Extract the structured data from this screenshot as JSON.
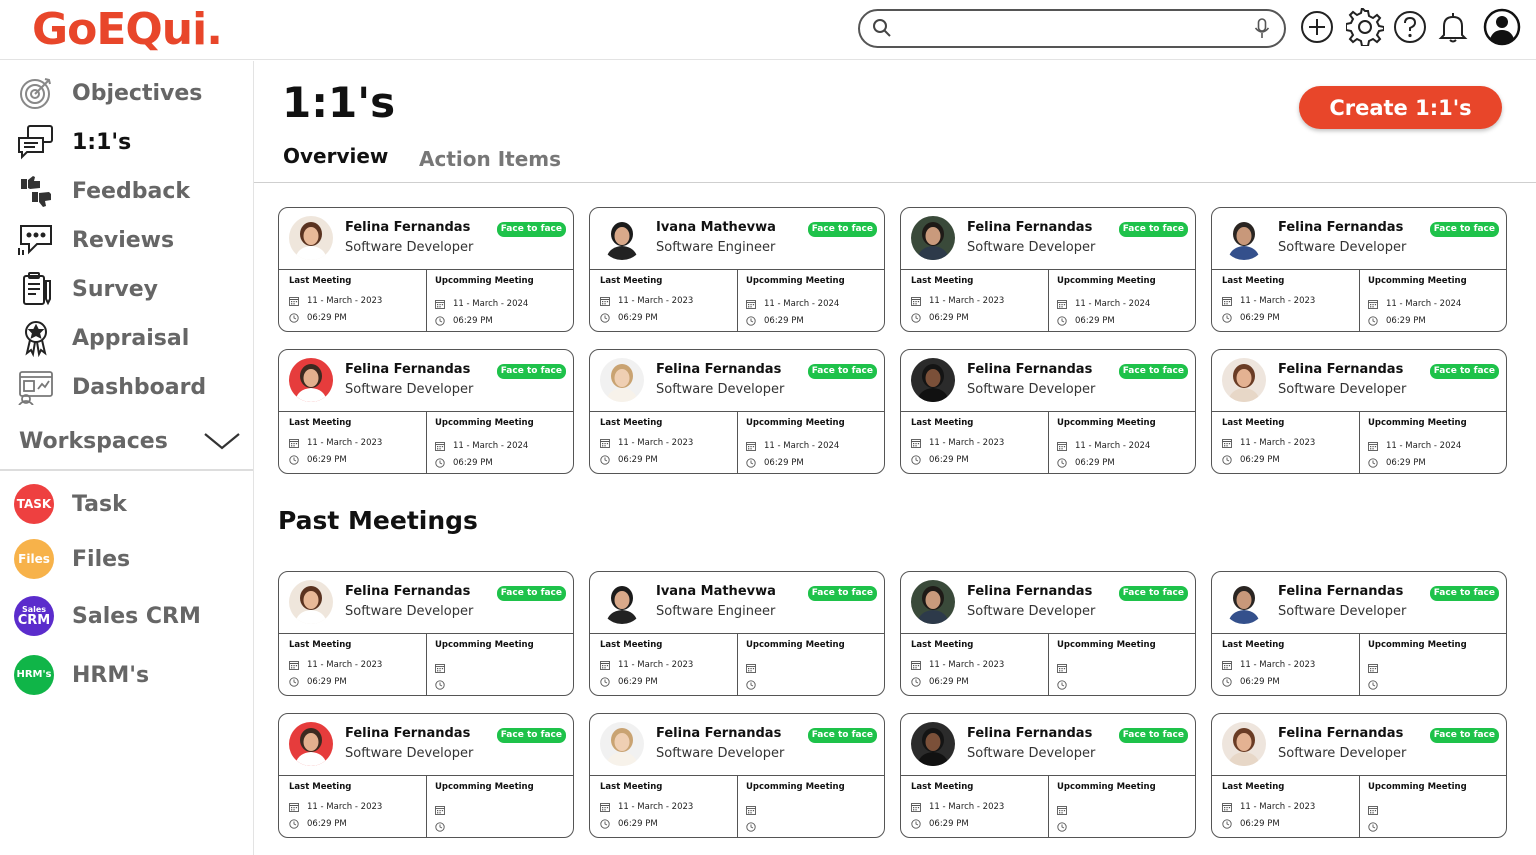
{
  "app": {
    "logo": "GoEQui."
  },
  "search": {
    "placeholder": ""
  },
  "header_icons": [
    "plus-circle-icon",
    "gear-icon",
    "help-icon",
    "bell-icon",
    "user-account-icon"
  ],
  "sidebar": {
    "items": [
      {
        "label": "Objectives",
        "icon": "target-icon"
      },
      {
        "label": "1:1's",
        "icon": "chat-icon",
        "active": true
      },
      {
        "label": "Feedback",
        "icon": "thumbs-icon"
      },
      {
        "label": "Reviews",
        "icon": "review-icon"
      },
      {
        "label": "Survey",
        "icon": "clipboard-icon"
      },
      {
        "label": "Appraisal",
        "icon": "award-icon"
      },
      {
        "label": "Dashboard",
        "icon": "dashboard-icon"
      }
    ],
    "workspaces_label": "Workspaces",
    "workspaces": [
      {
        "label": "Task",
        "badge": "TASK",
        "color": "#ee4040"
      },
      {
        "label": "Files",
        "badge": "Files",
        "color": "#f7b24a"
      },
      {
        "label": "Sales CRM",
        "badge_top": "Sales",
        "badge": "CRM",
        "color": "#5b2ccc"
      },
      {
        "label": "HRM's",
        "badge": "HRM's",
        "color": "#10b548"
      }
    ]
  },
  "main": {
    "title": "1:1's",
    "create_button": "Create 1:1's",
    "tabs": [
      {
        "label": "Overview",
        "active": true
      },
      {
        "label": "Action Items"
      }
    ],
    "past_title": "Past Meetings",
    "labels": {
      "last": "Last Meeting",
      "upcoming": "Upcomming Meeting",
      "badge": "Face to face"
    },
    "upcoming_cards": [
      {
        "name": "Felina Fernandas",
        "role": "Software Developer",
        "last_date": "11 - March - 2023",
        "last_time": "06:29 PM",
        "up_date": "11 - March - 2024",
        "up_time": "06:29 PM",
        "avatar": "woman-smiling"
      },
      {
        "name": "Ivana Mathevwa",
        "role": "Software Engineer",
        "last_date": "11 - March - 2023",
        "last_time": "06:29 PM",
        "up_date": "11 - March - 2024",
        "up_time": "06:29 PM",
        "avatar": "woman-suit"
      },
      {
        "name": "Felina Fernandas",
        "role": "Software Developer",
        "last_date": "11 - March - 2023",
        "last_time": "06:29 PM",
        "up_date": "11 - March - 2024",
        "up_time": "06:29 PM",
        "avatar": "man-beard"
      },
      {
        "name": "Felina Fernandas",
        "role": "Software Developer",
        "last_date": "11 - March - 2023",
        "last_time": "06:29 PM",
        "up_date": "11 - March - 2024",
        "up_time": "06:29 PM",
        "avatar": "man-arms-crossed"
      },
      {
        "name": "Felina Fernandas",
        "role": "Software Developer",
        "last_date": "11 - March - 2023",
        "last_time": "06:29 PM",
        "up_date": "11 - March - 2024",
        "up_time": "06:29 PM",
        "avatar": "man-red-bg"
      },
      {
        "name": "Felina Fernandas",
        "role": "Software Developer",
        "last_date": "11 - March - 2023",
        "last_time": "06:29 PM",
        "up_date": "11 - March - 2024",
        "up_time": "06:29 PM",
        "avatar": "woman-blonde"
      },
      {
        "name": "Felina Fernandas",
        "role": "Software Developer",
        "last_date": "11 - March - 2023",
        "last_time": "06:29 PM",
        "up_date": "11 - March - 2024",
        "up_time": "06:29 PM",
        "avatar": "woman-dark"
      },
      {
        "name": "Felina Fernandas",
        "role": "Software Developer",
        "last_date": "11 - March - 2023",
        "last_time": "06:29 PM",
        "up_date": "11 - March - 2024",
        "up_time": "06:29 PM",
        "avatar": "woman-smiling-2"
      }
    ],
    "past_cards": [
      {
        "name": "Felina Fernandas",
        "role": "Software Developer",
        "last_date": "11 - March - 2023",
        "last_time": "06:29 PM",
        "up_date": "",
        "up_time": "",
        "avatar": "woman-smiling"
      },
      {
        "name": "Ivana Mathevwa",
        "role": "Software Engineer",
        "last_date": "11 - March - 2023",
        "last_time": "06:29 PM",
        "up_date": "",
        "up_time": "",
        "avatar": "woman-suit"
      },
      {
        "name": "Felina Fernandas",
        "role": "Software Developer",
        "last_date": "11 - March - 2023",
        "last_time": "06:29 PM",
        "up_date": "",
        "up_time": "",
        "avatar": "man-beard"
      },
      {
        "name": "Felina Fernandas",
        "role": "Software Developer",
        "last_date": "11 - March - 2023",
        "last_time": "06:29 PM",
        "up_date": "",
        "up_time": "",
        "avatar": "man-arms-crossed"
      },
      {
        "name": "Felina Fernandas",
        "role": "Software Developer",
        "last_date": "11 - March - 2023",
        "last_time": "06:29 PM",
        "up_date": "",
        "up_time": "",
        "avatar": "man-red-bg"
      },
      {
        "name": "Felina Fernandas",
        "role": "Software Developer",
        "last_date": "11 - March - 2023",
        "last_time": "06:29 PM",
        "up_date": "",
        "up_time": "",
        "avatar": "woman-blonde"
      },
      {
        "name": "Felina Fernandas",
        "role": "Software Developer",
        "last_date": "11 - March - 2023",
        "last_time": "06:29 PM",
        "up_date": "",
        "up_time": "",
        "avatar": "woman-dark"
      },
      {
        "name": "Felina Fernandas",
        "role": "Software Developer",
        "last_date": "11 - March - 2023",
        "last_time": "06:29 PM",
        "up_date": "",
        "up_time": "",
        "avatar": "woman-smiling-2"
      }
    ]
  },
  "colors": {
    "brand": "#e8462a",
    "badge_green": "#1ec24a",
    "border": "#555555"
  }
}
